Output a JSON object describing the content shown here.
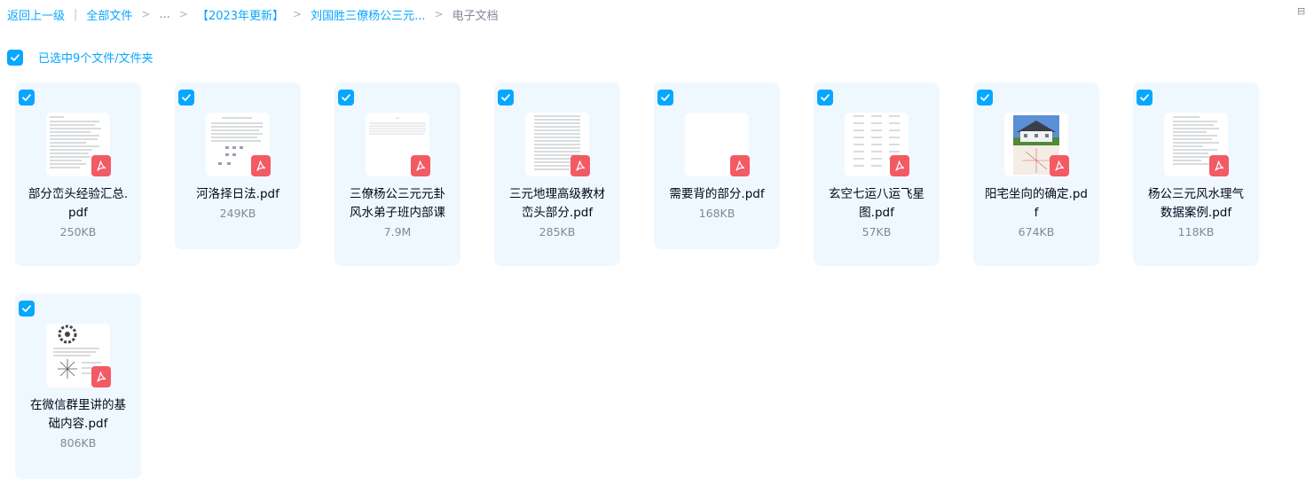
{
  "breadcrumb": {
    "back": "返回上一级",
    "all_files": "全部文件",
    "ellipsis": "...",
    "folder1": "【2023年更新】",
    "folder2": "刘国胜三僚杨公三元...",
    "current": "电子文档"
  },
  "selection": {
    "text": "已选中9个文件/文件夹"
  },
  "colors": {
    "accent": "#06a7ff",
    "card_bg": "#f0f8ff",
    "pdf_red": "#f35a64",
    "muted": "#818999"
  },
  "files": [
    {
      "name_line1": "部分峦头经验汇总.",
      "name_line2": "pdf",
      "size": "250KB"
    },
    {
      "name_line1": "河洛择日法.pdf",
      "name_line2": "",
      "size": "249KB"
    },
    {
      "name_line1": "三僚杨公三元元卦",
      "name_line2": "风水弟子班内部课",
      "size": "7.9M"
    },
    {
      "name_line1": "三元地理高级教材",
      "name_line2": "峦头部分.pdf",
      "size": "285KB"
    },
    {
      "name_line1": "需要背的部分.pdf",
      "name_line2": "",
      "size": "168KB"
    },
    {
      "name_line1": "玄空七运八运飞星",
      "name_line2": "图.pdf",
      "size": "57KB"
    },
    {
      "name_line1": "阳宅坐向的确定.pd",
      "name_line2": "f",
      "size": "674KB"
    },
    {
      "name_line1": "杨公三元风水理气",
      "name_line2": "数据案例.pdf",
      "size": "118KB"
    },
    {
      "name_line1": "在微信群里讲的基",
      "name_line2": "础内容.pdf",
      "size": "806KB"
    }
  ]
}
